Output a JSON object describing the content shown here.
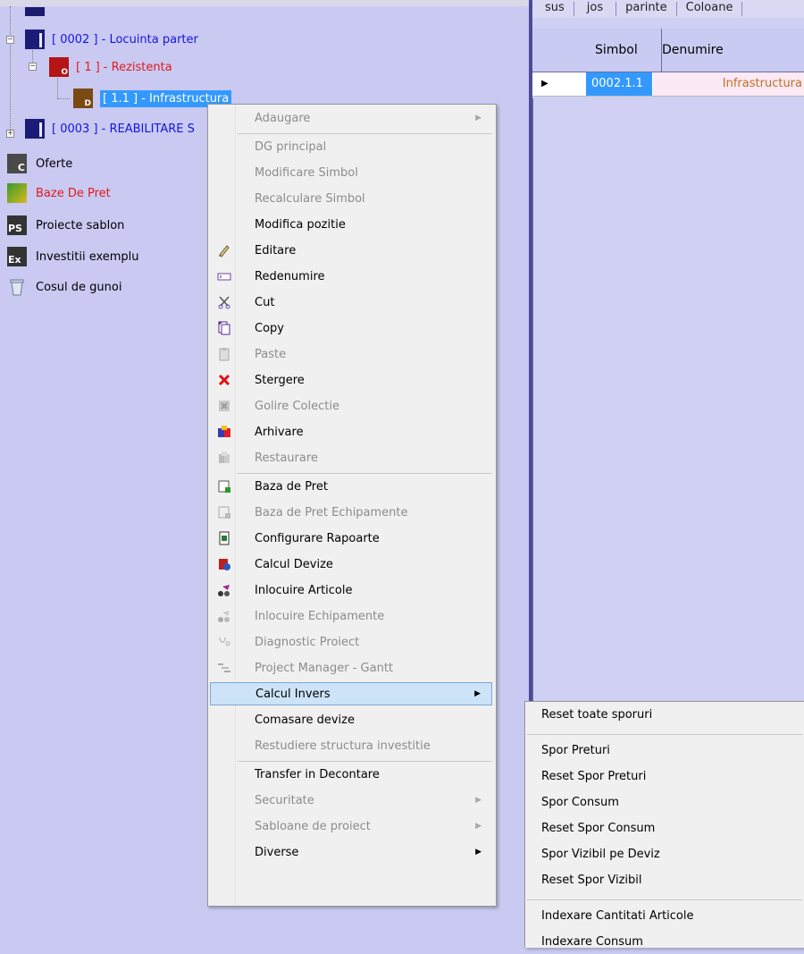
{
  "tree": {
    "nodes": [
      {
        "label": "[ 0002 ] - Locuinta parter",
        "color": "#1515e0"
      },
      {
        "label": "[ 1 ] - Rezistenta",
        "color": "#e21b1b"
      },
      {
        "label": "[ 1.1 ] - Infrastructura",
        "color": "#ffffff"
      },
      {
        "label": "[ 0003 ] - REABILITARE S",
        "color": "#1515e0"
      }
    ],
    "root_items": [
      {
        "label": "Oferte",
        "color": "#000000"
      },
      {
        "label": "Baze De Pret",
        "color": "#e21b1b"
      },
      {
        "label": "Proiecte sablon",
        "color": "#000000"
      },
      {
        "label": "Investitii exemplu",
        "color": "#000000"
      },
      {
        "label": "Cosul de gunoi",
        "color": "#000000"
      }
    ],
    "icon_letters": {
      "oferte": "C",
      "sablon": "PS",
      "exemplu": "Ex",
      "rezistenta": "O",
      "infrastructura": "D"
    }
  },
  "grid": {
    "toolbar": [
      "sus",
      "jos",
      "parinte",
      "Coloane"
    ],
    "headers": [
      "Simbol",
      "Denumire"
    ],
    "row": {
      "simbol": "0002.1.1",
      "denumire": "Infrastructura"
    }
  },
  "context_menu": {
    "items": [
      {
        "label": "Adaugare",
        "enabled": false,
        "submenu": true,
        "icon": "none"
      },
      {
        "sep": true
      },
      {
        "label": "DG principal",
        "enabled": false,
        "icon": "none"
      },
      {
        "label": "Modificare Simbol",
        "enabled": false,
        "icon": "none"
      },
      {
        "label": "Recalculare Simbol",
        "enabled": false,
        "icon": "none"
      },
      {
        "label": "Modifica pozitie",
        "enabled": true,
        "icon": "none"
      },
      {
        "label": "Editare",
        "enabled": true,
        "icon": "pencil-icon"
      },
      {
        "label": "Redenumire",
        "enabled": true,
        "icon": "rename-icon"
      },
      {
        "label": "Cut",
        "enabled": true,
        "icon": "scissors-icon"
      },
      {
        "label": "Copy",
        "enabled": true,
        "icon": "copy-icon"
      },
      {
        "label": "Paste",
        "enabled": false,
        "icon": "paste-icon"
      },
      {
        "label": "Stergere",
        "enabled": true,
        "icon": "delete-x-icon"
      },
      {
        "label": "Golire Colectie",
        "enabled": false,
        "icon": "empty-collection-icon"
      },
      {
        "label": "Arhivare",
        "enabled": true,
        "icon": "archive-icon"
      },
      {
        "label": "Restaurare",
        "enabled": false,
        "icon": "restore-icon"
      },
      {
        "sep": true
      },
      {
        "label": "Baza de Pret",
        "enabled": true,
        "icon": "price-base-icon"
      },
      {
        "label": "Baza de Pret Echipamente",
        "enabled": false,
        "icon": "equipment-price-icon"
      },
      {
        "label": "Configurare Rapoarte",
        "enabled": true,
        "icon": "report-config-icon"
      },
      {
        "label": "Calcul Devize",
        "enabled": true,
        "icon": "calculate-icon"
      },
      {
        "label": "Inlocuire Articole",
        "enabled": true,
        "icon": "replace-articles-icon"
      },
      {
        "label": "Inlocuire Echipamente",
        "enabled": false,
        "icon": "replace-equipment-icon"
      },
      {
        "label": "Diagnostic Proiect",
        "enabled": false,
        "icon": "diagnostic-icon"
      },
      {
        "label": "Project Manager - Gantt",
        "enabled": false,
        "icon": "gantt-icon"
      },
      {
        "label": "Calcul Invers",
        "enabled": true,
        "submenu": true,
        "highlighted": true,
        "icon": "none"
      },
      {
        "label": "Comasare devize",
        "enabled": true,
        "icon": "none"
      },
      {
        "label": "Restudiere structura investitie",
        "enabled": false,
        "icon": "none"
      },
      {
        "sep": true
      },
      {
        "label": "Transfer in Decontare",
        "enabled": true,
        "icon": "none"
      },
      {
        "label": "Securitate",
        "enabled": false,
        "submenu": true,
        "icon": "none"
      },
      {
        "label": "Sabloane de proiect",
        "enabled": false,
        "submenu": true,
        "icon": "none"
      },
      {
        "label": "Diverse",
        "enabled": true,
        "submenu": true,
        "icon": "none"
      }
    ]
  },
  "submenu": {
    "items": [
      {
        "label": "Reset toate sporuri"
      },
      {
        "sep": true
      },
      {
        "label": "Spor Preturi"
      },
      {
        "label": "Reset Spor Preturi"
      },
      {
        "label": "Spor Consum"
      },
      {
        "label": "Reset Spor Consum"
      },
      {
        "label": "Spor Vizibil pe Deviz"
      },
      {
        "label": "Reset Spor Vizibil"
      },
      {
        "sep": true
      },
      {
        "label": "Indexare Cantitati Articole"
      },
      {
        "label": "Indexare Consum"
      }
    ]
  }
}
